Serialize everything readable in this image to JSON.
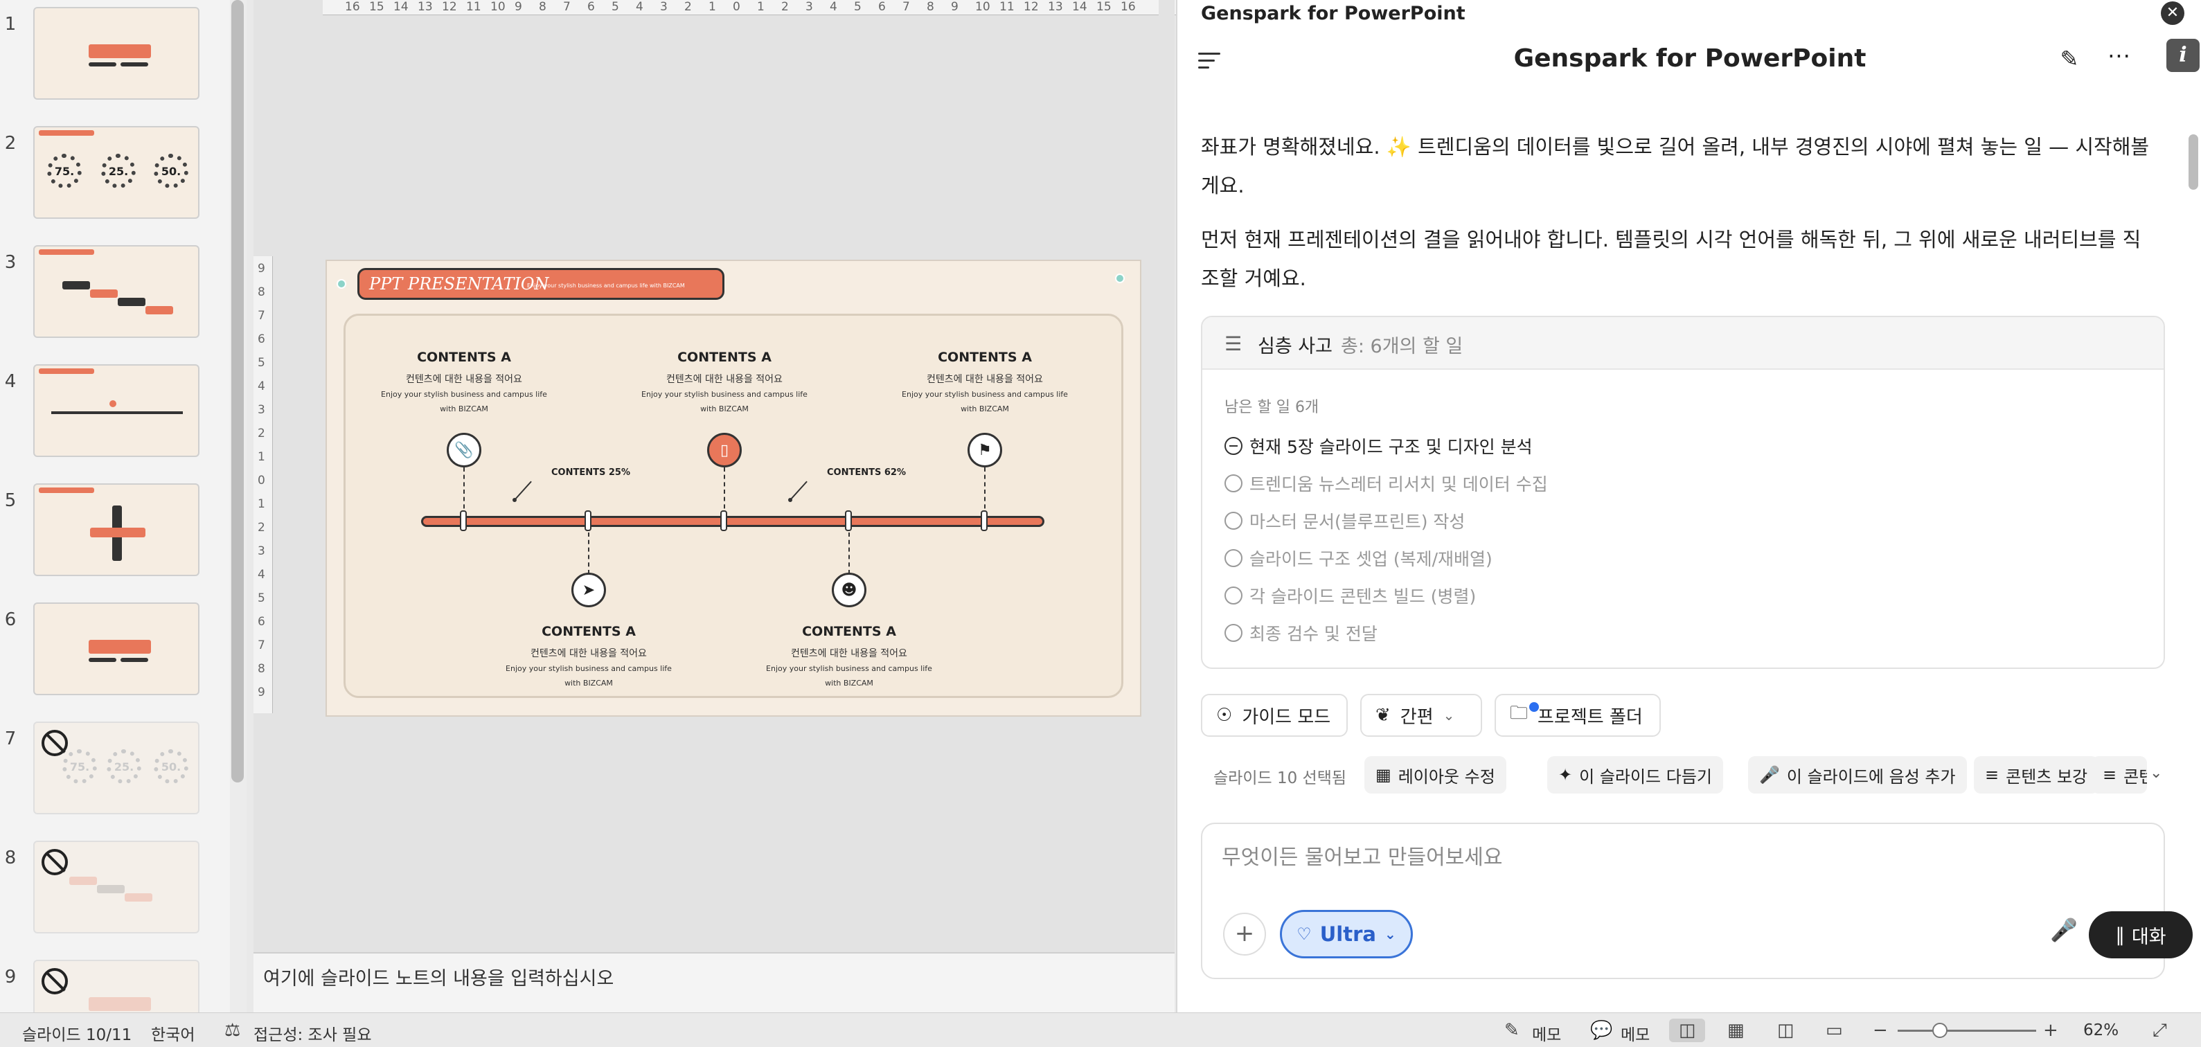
{
  "thumbnails": {
    "numbers": [
      "1",
      "2",
      "3",
      "4",
      "5",
      "6",
      "7",
      "8",
      "9"
    ],
    "slide2_values": [
      "75.",
      "25.",
      "50."
    ],
    "slide7_values": [
      "75.",
      "25.",
      "50."
    ]
  },
  "slide": {
    "title": "PPT PRESENTATION",
    "subtitle": "Enjoy your stylish business and campus life with BIZCAM",
    "blocks": [
      {
        "heading": "CONTENTS A",
        "ko": "컨텐츠에 대한 내용을 적어요",
        "en": "Enjoy your stylish business and campus life with BIZCAM"
      },
      {
        "heading": "CONTENTS A",
        "ko": "컨텐츠에 대한 내용을 적어요",
        "en": "Enjoy your stylish business and campus life with BIZCAM"
      },
      {
        "heading": "CONTENTS A",
        "ko": "컨텐츠에 대한 내용을 적어요",
        "en": "Enjoy your stylish business and campus life with BIZCAM"
      },
      {
        "heading": "CONTENTS A",
        "ko": "컨텐츠에 대한 내용을 적어요",
        "en": "Enjoy your stylish business and campus life with BIZCAM"
      },
      {
        "heading": "CONTENTS A",
        "ko": "컨텐츠에 대한 내용을 적어요",
        "en": "Enjoy your stylish business and campus life with BIZCAM"
      }
    ],
    "percent_labels": [
      "CONTENTS 25%",
      "CONTENTS 62%"
    ]
  },
  "ruler": {
    "horizontal": [
      "16",
      "15",
      "14",
      "13",
      "12",
      "11",
      "10",
      "9",
      "8",
      "7",
      "6",
      "5",
      "4",
      "3",
      "2",
      "1",
      "0",
      "1",
      "2",
      "3",
      "4",
      "5",
      "6",
      "7",
      "8",
      "9",
      "10",
      "11",
      "12",
      "13",
      "14",
      "15",
      "16"
    ],
    "vertical": [
      "9",
      "8",
      "7",
      "6",
      "5",
      "4",
      "3",
      "2",
      "1",
      "0",
      "1",
      "2",
      "3",
      "4",
      "5",
      "6",
      "7",
      "8",
      "9"
    ]
  },
  "notes_placeholder": "여기에 슬라이드 노트의 내용을 입력하십시오",
  "panel": {
    "window_title": "Genspark for PowerPoint",
    "header_title": "Genspark for PowerPoint",
    "close_glyph": "✕",
    "info_glyph": "i",
    "message_1": "좌표가 명확해졌네요. ✨ 트렌디움의 데이터를 빛으로 길어 올려, 내부 경영진의 시야에 펼쳐 놓는 일 — 시작해볼게요.",
    "message_2": "먼저 현재 프레젠테이션의 결을 읽어내야 합니다. 템플릿의 시각 언어를 해독한 뒤, 그 위에 새로운 내러티브를 직조할 거예요.",
    "task_card": {
      "title": "심층 사고",
      "count": "총: 6개의 할 일",
      "remaining": "남은 할 일 6개",
      "items": [
        "현재 5장 슬라이드 구조 및 디자인 분석",
        "트렌디움 뉴스레터 리서치 및 데이터 수집",
        "마스터 문서(블루프린트) 작성",
        "슬라이드 구조 셋업 (복제/재배열)",
        "각 슬라이드 콘텐츠 빌드 (병렬)",
        "최종 검수 및 전달"
      ]
    },
    "mode_pills": {
      "guide": "가이드 모드",
      "concise": "간편",
      "project_folder": "프로젝트 폴더"
    },
    "actions": {
      "slides_selected": "슬라이드 10 선택됨",
      "layout": "레이아웃 수정",
      "polish": "이 슬라이드 다듬기",
      "voice": "이 슬라이드에 음성 추가",
      "enhance": "콘텐츠 보강",
      "more": "콘텐"
    },
    "composer": {
      "placeholder": "무엇이든 물어보고 만들어보세요",
      "model": "Ultra",
      "talk_label": "대화"
    }
  },
  "statusbar": {
    "slide_position": "슬라이드 10/11",
    "language": "한국어",
    "accessibility": "접근성: 조사 필요",
    "notes_label": "메모",
    "comments_label": "메모",
    "zoom": "62%"
  },
  "colors": {
    "accent": "#e8775a",
    "teal": "#8cd3c8",
    "ultra_blue": "#3a74d8"
  }
}
